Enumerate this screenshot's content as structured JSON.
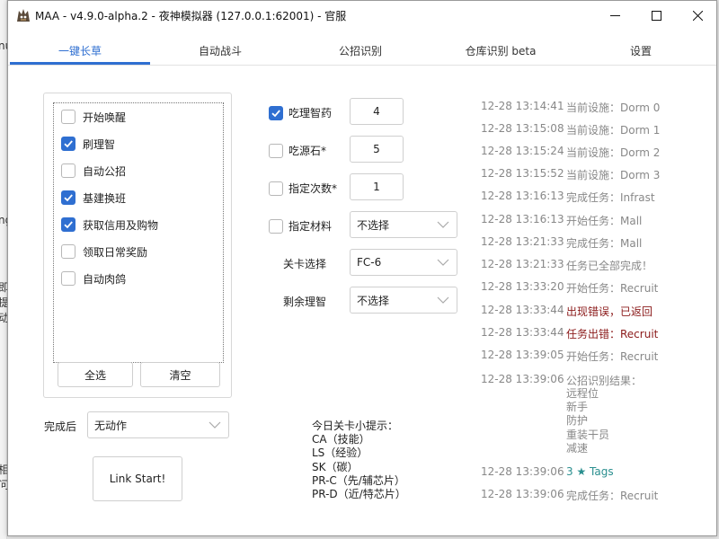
{
  "background": {
    "fragments": [
      "nu",
      "ng",
      "即",
      "提",
      "动",
      "相",
      "问"
    ]
  },
  "window": {
    "title": "MAA - v4.9.0-alpha.2 - 夜神模拟器 (127.0.0.1:62001) - 官服"
  },
  "tabs": [
    {
      "label": "一键长草"
    },
    {
      "label": "自动战斗"
    },
    {
      "label": "公招识别"
    },
    {
      "label": "仓库识别 beta"
    },
    {
      "label": "设置"
    }
  ],
  "tasks": [
    {
      "label": "开始唤醒",
      "checked": false
    },
    {
      "label": "刷理智",
      "checked": true
    },
    {
      "label": "自动公招",
      "checked": false
    },
    {
      "label": "基建换班",
      "checked": true
    },
    {
      "label": "获取信用及购物",
      "checked": true
    },
    {
      "label": "领取日常奖励",
      "checked": false
    },
    {
      "label": "自动肉鸽",
      "checked": false
    }
  ],
  "buttons": {
    "select_all": "全选",
    "clear": "清空",
    "link_start": "Link Start!"
  },
  "after_complete": {
    "label": "完成后",
    "value": "无动作"
  },
  "fight": {
    "medicine": {
      "label": "吃理智药",
      "checked": true,
      "value": "4"
    },
    "stone": {
      "label": "吃源石*",
      "checked": false,
      "value": "5"
    },
    "times": {
      "label": "指定次数*",
      "checked": false,
      "value": "1"
    },
    "material": {
      "label": "指定材料",
      "checked": false,
      "value": "不选择"
    },
    "stage": {
      "label": "关卡选择",
      "value": "FC-6"
    },
    "remaining": {
      "label": "剩余理智",
      "value": "不选择"
    }
  },
  "tips": {
    "title": "今日关卡小提示：",
    "lines": [
      "CA（技能）",
      "LS（经验）",
      "SK（碳）",
      "PR-C（先/辅芯片）",
      "PR-D（近/特芯片）"
    ]
  },
  "log": [
    {
      "time": "12-28  13:14:41",
      "msg": "当前设施：Dorm 0",
      "style": "normal"
    },
    {
      "time": "12-28  13:15:08",
      "msg": "当前设施：Dorm 1",
      "style": "normal"
    },
    {
      "time": "12-28  13:15:24",
      "msg": "当前设施：Dorm 2",
      "style": "normal"
    },
    {
      "time": "12-28  13:15:52",
      "msg": "当前设施：Dorm 3",
      "style": "normal"
    },
    {
      "time": "12-28  13:16:13",
      "msg": "完成任务：Infrast",
      "style": "normal"
    },
    {
      "time": "12-28  13:16:13",
      "msg": "开始任务：Mall",
      "style": "normal"
    },
    {
      "time": "12-28  13:21:33",
      "msg": "完成任务：Mall",
      "style": "normal"
    },
    {
      "time": "12-28  13:21:33",
      "msg": "任务已全部完成！",
      "style": "normal"
    },
    {
      "time": "12-28  13:33:20",
      "msg": "开始任务：Recruit",
      "style": "normal"
    },
    {
      "time": "12-28  13:33:44",
      "msg": "出现错误，已返回",
      "style": "err"
    },
    {
      "time": "12-28  13:33:44",
      "msg": "任务出错：Recruit",
      "style": "err"
    },
    {
      "time": "12-28  13:39:05",
      "msg": "开始任务：Recruit",
      "style": "normal"
    },
    {
      "time": "12-28  13:39:06",
      "msg": "公招识别结果：",
      "style": "normal"
    },
    {
      "time": "12-28  13:39:06",
      "msg": "3 ★ Tags",
      "style": "teal"
    },
    {
      "time": "12-28  13:39:06",
      "msg": "完成任务：Recruit",
      "style": "normal"
    }
  ],
  "recruit_tags": [
    "远程位",
    "新手",
    "防护",
    "重装干员",
    "减速"
  ],
  "colors": {
    "accent": "#2f6fd1",
    "error": "#8b1a1a",
    "tag": "#2a8f8f",
    "log_gray": "#888888"
  }
}
